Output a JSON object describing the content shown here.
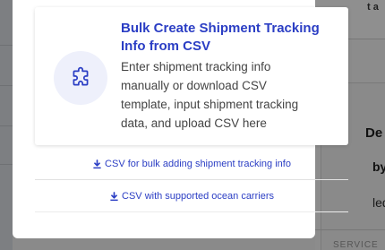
{
  "modal": {
    "option": {
      "title": "Bulk Create Shipment Tracking Info from CSV",
      "description": "Enter shipment tracking info manually or download CSV template, input shipment tracking data, and upload CSV here",
      "icon": "puzzle-icon"
    },
    "downloads": [
      {
        "label": "CSV for bulk adding shipment tracking info",
        "icon": "download-icon"
      },
      {
        "label": "CSV with supported ocean carriers",
        "icon": "download-icon"
      }
    ]
  },
  "background": {
    "top_right_text": "t a",
    "heading_fragment": "De",
    "by_fragment": "by",
    "row_fragment": "led",
    "bottom_fragment": "SERVICE"
  },
  "colors": {
    "accent": "#2b3ec4",
    "icon_bg": "#eef0fb",
    "overlay": "#8a8a8a"
  }
}
